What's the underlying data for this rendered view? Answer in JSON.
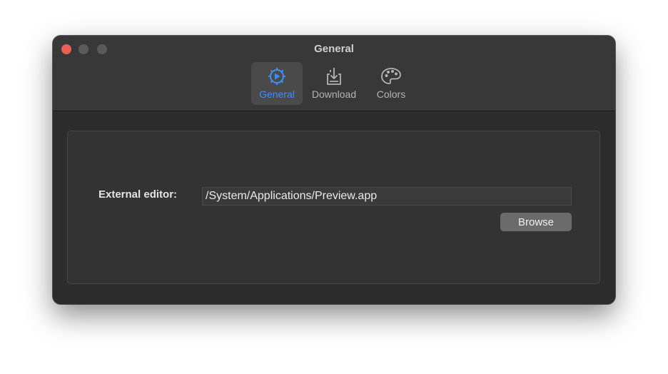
{
  "window": {
    "title": "General"
  },
  "toolbar": {
    "items": [
      {
        "label": "General",
        "icon": "gear-icon",
        "selected": true
      },
      {
        "label": "Download",
        "icon": "download-tray-icon",
        "selected": false
      },
      {
        "label": "Colors",
        "icon": "palette-icon",
        "selected": false
      }
    ]
  },
  "settings": {
    "external_editor_label": "External editor:",
    "external_editor_value": "/System/Applications/Preview.app",
    "browse_label": "Browse"
  },
  "colors": {
    "accent": "#3f8ef6",
    "close": "#ec5f57",
    "window_bg": "#2c2c2c"
  }
}
